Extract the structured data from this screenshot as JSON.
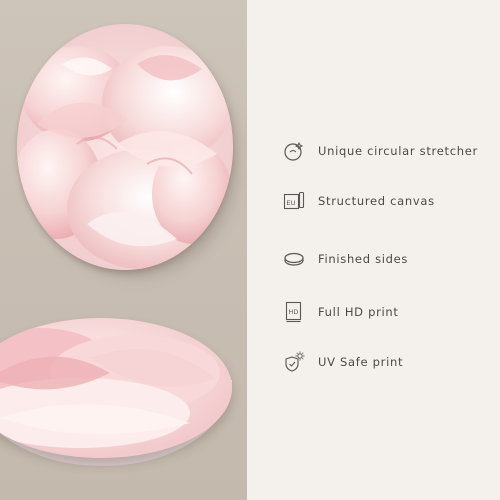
{
  "features": [
    {
      "icon": "circle-stretcher-icon",
      "label": "Unique circular stretcher"
    },
    {
      "icon": "eu-canvas-icon",
      "label": "Structured canvas"
    },
    {
      "icon": "finished-sides-icon",
      "label": "Finished sides"
    },
    {
      "icon": "hd-print-icon",
      "label": "Full HD print"
    },
    {
      "icon": "uv-shield-icon",
      "label": "UV Safe print"
    }
  ],
  "icon_text": {
    "eu": "EU",
    "hd": "HD"
  },
  "colors": {
    "background": "#f4f0ec",
    "wall": "#c8beb3",
    "text": "#4d4a47",
    "icon": "#5a5653",
    "petal": "#f2c9cc"
  }
}
